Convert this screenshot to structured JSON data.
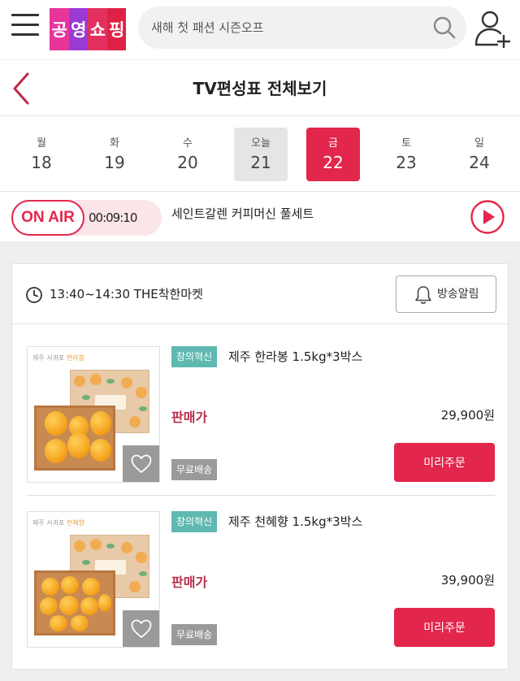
{
  "header": {
    "menu_icon": "hamburger-menu-icon",
    "logo_text": "공영쇼핑",
    "search_placeholder": "새해 첫 패션 시즌오프",
    "search_icon": "search-icon",
    "user_icon": "user-add-icon"
  },
  "title_bar": {
    "back_icon": "chevron-left-icon",
    "title": "TV편성표 전체보기"
  },
  "days": [
    {
      "dow": "월",
      "date": "18",
      "state": "normal"
    },
    {
      "dow": "화",
      "date": "19",
      "state": "normal"
    },
    {
      "dow": "수",
      "date": "20",
      "state": "normal"
    },
    {
      "dow": "오늘",
      "date": "21",
      "state": "today"
    },
    {
      "dow": "금",
      "date": "22",
      "state": "selected"
    },
    {
      "dow": "토",
      "date": "23",
      "state": "normal"
    },
    {
      "dow": "일",
      "date": "24",
      "state": "normal"
    }
  ],
  "on_air": {
    "badge": "ON AIR",
    "timer": "00:09:10",
    "title": "세인트갈렌 커피머신 풀세트",
    "play_icon": "play-circle-icon"
  },
  "schedule": {
    "time_slot": "13:40~14:30 THE착한마켓",
    "alarm_label": "방송알림",
    "products": [
      {
        "tag": "창의혁신",
        "name": "제주 한라봉 1.5kg*3박스",
        "price_label": "판매가",
        "price": "29,900원",
        "shipping": "무료배송",
        "order_label": "미리주문",
        "thumb_caption_a": "제주 서귀포",
        "thumb_caption_b": "한라봉"
      },
      {
        "tag": "창의혁신",
        "name": "제주 천혜향 1.5kg*3박스",
        "price_label": "판매가",
        "price": "39,900원",
        "shipping": "무료배송",
        "order_label": "미리주문",
        "thumb_caption_a": "제주 서귀포",
        "thumb_caption_b": "천혜향"
      }
    ]
  },
  "colors": {
    "brand_red": "#e3264b",
    "tag_teal": "#5fb9b0",
    "price_label": "#b8304c"
  }
}
